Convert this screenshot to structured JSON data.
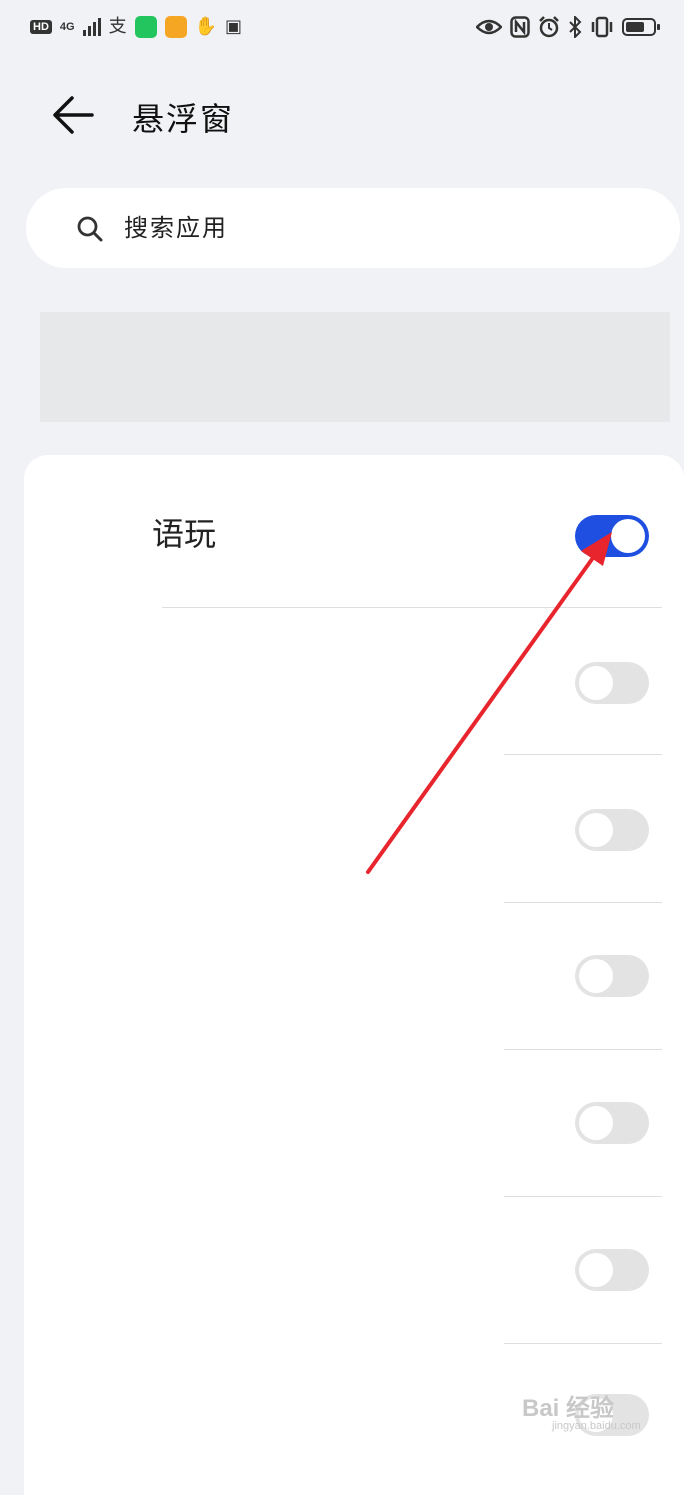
{
  "status_bar": {
    "hd": "HD",
    "network": "4G",
    "alipay_glyph": "支",
    "icons_left": [
      "hd-badge",
      "signal-icon",
      "alipay-icon",
      "message-app-icon",
      "orange-app-icon",
      "hand-icon",
      "card-icon"
    ],
    "icons_right": [
      "eye-icon",
      "nfc-icon",
      "alarm-icon",
      "bluetooth-icon",
      "vibrate-icon",
      "battery-icon"
    ],
    "battery_level": 0.7
  },
  "header": {
    "back_icon": "back-arrow-icon",
    "title": "悬浮窗"
  },
  "search": {
    "icon": "search-icon",
    "placeholder": "搜索应用"
  },
  "apps": [
    {
      "name": "语玩",
      "enabled": true
    },
    {
      "name": "",
      "enabled": false
    },
    {
      "name": "",
      "enabled": false
    },
    {
      "name": "",
      "enabled": false
    },
    {
      "name": "",
      "enabled": false
    },
    {
      "name": "",
      "enabled": false
    },
    {
      "name": "",
      "enabled": false
    }
  ],
  "annotation": {
    "arrow_color": "#e8242c"
  },
  "watermark": {
    "text": "Bai 经验",
    "sub": "jingyan.baidu.com"
  },
  "colors": {
    "accent": "#1f4fe0",
    "background": "#f1f2f5",
    "toggle_off": "#e3e3e3"
  }
}
